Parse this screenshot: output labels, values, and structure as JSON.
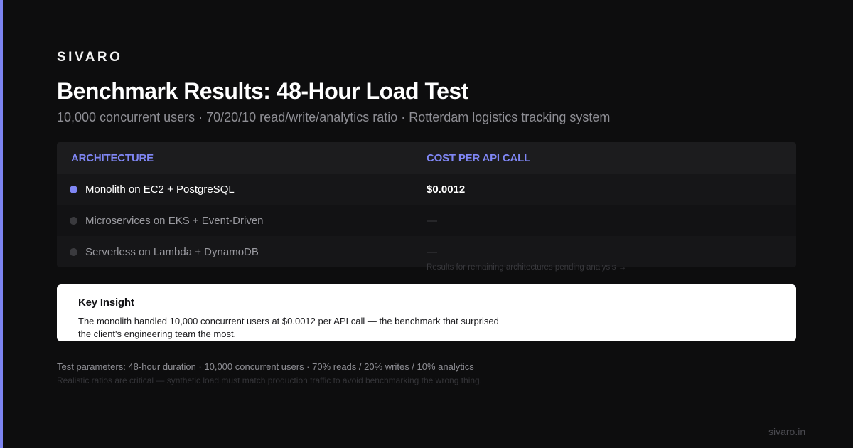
{
  "brand": "SIVARO",
  "title": "Benchmark Results: 48-Hour Load Test",
  "subtitle": "10,000 concurrent users · 70/20/10 read/write/analytics ratio · Rotterdam logistics tracking system",
  "table": {
    "headers": {
      "architecture": "ARCHITECTURE",
      "cost": "COST PER API CALL"
    },
    "rows": [
      {
        "architecture": "Monolith on EC2 + PostgreSQL",
        "cost": "$0.0012",
        "active": true
      },
      {
        "architecture": "Microservices on EKS + Event-Driven",
        "cost": "—",
        "active": false
      },
      {
        "architecture": "Serverless on Lambda + DynamoDB",
        "cost": "—",
        "active": false
      }
    ],
    "pending_note": "Results for remaining architectures pending analysis →"
  },
  "insight": {
    "title": "Key Insight",
    "body": "The monolith handled 10,000 concurrent users at $0.0012 per API call — the benchmark that surprised the client's engineering team the most."
  },
  "footer": {
    "params": "Test parameters: 48-hour duration · 10,000 concurrent users · 70% reads / 20% writes / 10% analytics",
    "note": "Realistic ratios are critical — synthetic load must match production traffic to avoid benchmarking the wrong thing.",
    "site": "sivaro.in"
  },
  "colors": {
    "background": "#0d0d0e",
    "accent": "#7c83f0",
    "card": "#ffffff"
  }
}
